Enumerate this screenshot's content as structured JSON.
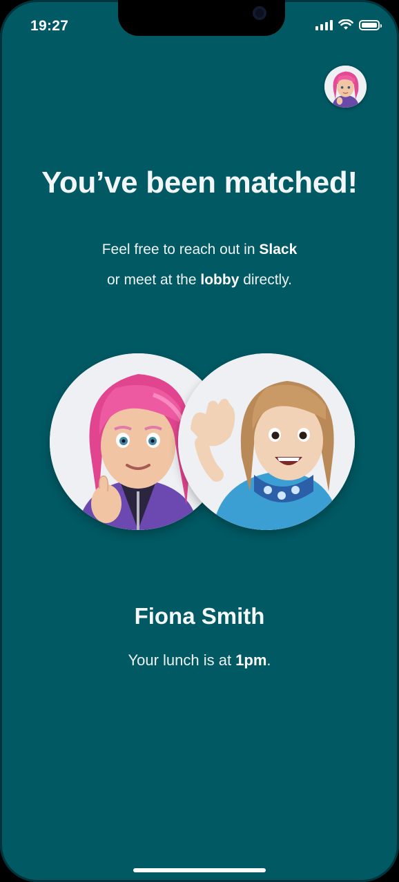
{
  "status_bar": {
    "time": "19:27"
  },
  "header": {
    "profile_avatar_icon": "memoji-pink-hair-avatar-icon"
  },
  "match_screen": {
    "title": "You’ve been matched!",
    "subtitle": {
      "line1_prefix": "Feel free to reach out in ",
      "line1_bold": "Slack",
      "line2_prefix": "or meet at the ",
      "line2_bold": "lobby",
      "line2_suffix": " directly."
    },
    "avatars": [
      "memoji-pink-hair-avatar-icon",
      "memoji-waving-blonde-avatar-icon"
    ],
    "matched_name": "Fiona Smith",
    "lunch": {
      "prefix": "Your lunch is at ",
      "time": "1pm",
      "suffix": "."
    }
  },
  "colors": {
    "background": "#005963",
    "text": "#ffffff",
    "avatar_bg": "#eef0f3"
  }
}
